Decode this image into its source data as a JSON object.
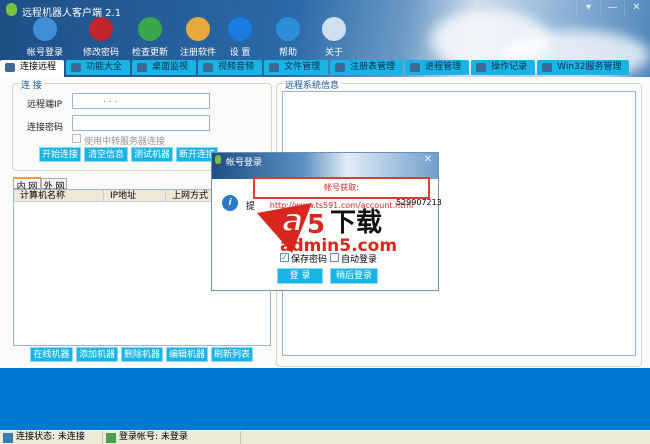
{
  "app": {
    "title": "远程机器人客户端 2.1",
    "window_controls": [
      "▾",
      "—",
      "✕"
    ]
  },
  "toolbar": [
    {
      "label": "帐号登录",
      "icon": "users-icon",
      "color": "#3f8fd8"
    },
    {
      "label": "修改密码",
      "icon": "lock-icon",
      "color": "#c0262c"
    },
    {
      "label": "检查更新",
      "icon": "globe-update-icon",
      "color": "#3aa84a"
    },
    {
      "label": "注册软件",
      "icon": "register-icon",
      "color": "#e8a93c"
    },
    {
      "label": "设 置",
      "icon": "gear-icon",
      "color": "#1a7be0"
    },
    {
      "label": "帮助",
      "icon": "help-icon",
      "color": "#2e8ed8"
    },
    {
      "label": "关于",
      "icon": "info-icon",
      "color": "#d0dff0"
    }
  ],
  "tabs": [
    "连接远程",
    "功能大全",
    "桌面监视",
    "视频音频",
    "文件管理",
    "注册表管理",
    "进程管理",
    "操作记录",
    "Win32服务管理"
  ],
  "connect": {
    "group_label": "连 接",
    "ip_label": "远程端IP",
    "ip_value": ".        .        .",
    "password_label": "连接密码",
    "relay_checkbox": "使用中转服务器连接",
    "relay_checked": false,
    "buttons": [
      "开始连接",
      "清空信息",
      "测试机器人",
      "断开连接"
    ]
  },
  "list": {
    "tabs": [
      "内 网",
      "外 网"
    ],
    "columns": [
      "计算机名称",
      "IP地址",
      "上网方式"
    ],
    "buttons": [
      "在线机器人",
      "添加机器人",
      "删除机器人",
      "编辑机器人",
      "刷新列表"
    ]
  },
  "remote_info": {
    "group_label": "远程系统信息"
  },
  "status": {
    "connection": "连接状态: 未连接",
    "account": "登录帐号: 未登录"
  },
  "dialog": {
    "title": "帐号登录",
    "account_link": "帐号获取: http://www.ts591.com/account.html",
    "hint_prefix": "提",
    "hint_suffix": "529907213",
    "save_password": "保存密码",
    "save_checked": true,
    "auto_login": "自动登录",
    "auto_checked": false,
    "login_button": "登 录",
    "later_button": "稍后登录"
  },
  "watermark": {
    "text": "a5下载",
    "site": "admin5.com"
  }
}
